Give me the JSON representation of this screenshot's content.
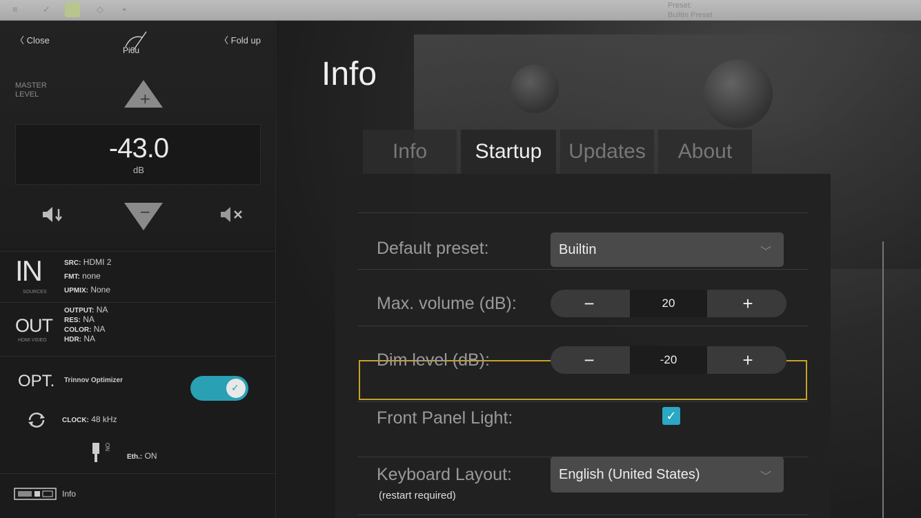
{
  "topbar": {
    "preset_line1": "Preset:",
    "preset_line2": "Builtin Preset"
  },
  "sidebar": {
    "close_label": "Close",
    "fold_label": "Fold up",
    "master_label": "MASTER LEVEL",
    "level_value": "-43.0",
    "level_unit": "dB",
    "in": {
      "big": "IN",
      "sub": "SOURCES",
      "rows": [
        {
          "k": "SRC:",
          "v": "HDMI 2"
        },
        {
          "k": "FMT:",
          "v": "none"
        },
        {
          "k": "UPMIX:",
          "v": "None"
        }
      ]
    },
    "out": {
      "big": "OUT",
      "sub": "HDMI VIDEO",
      "rows": [
        {
          "k": "OUTPUT:",
          "v": "NA"
        },
        {
          "k": "RES:",
          "v": "NA"
        },
        {
          "k": "COLOR:",
          "v": "NA"
        },
        {
          "k": "HDR:",
          "v": "NA"
        }
      ]
    },
    "opt": {
      "big": "OPT.",
      "label": "Trinnov Optimizer",
      "enabled": true
    },
    "clock": {
      "k": "CLOCK:",
      "v": "48 kHz"
    },
    "eth": {
      "side": "ON",
      "k": "Eth.:",
      "v": "ON"
    },
    "info_label": "Info"
  },
  "main": {
    "title": "Info",
    "tabs": [
      {
        "label": "Info"
      },
      {
        "label": "Startup"
      },
      {
        "label": "Updates"
      },
      {
        "label": "About"
      }
    ],
    "active_tab": "Startup",
    "default_preset": {
      "label": "Default preset:",
      "value": "Builtin"
    },
    "max_volume": {
      "label": "Max. volume (dB):",
      "value": "20",
      "minus": "−",
      "plus": "+"
    },
    "dim_level": {
      "label": "Dim level (dB):",
      "value": "-20",
      "minus": "−",
      "plus": "+"
    },
    "front_panel": {
      "label": "Front Panel Light:",
      "checked": true
    },
    "keyboard": {
      "label": "Keyboard Layout:",
      "sub": "(restart required)",
      "value": "English (United States)"
    }
  },
  "colors": {
    "accent": "#2aa8c4",
    "highlight": "#c9a227"
  }
}
